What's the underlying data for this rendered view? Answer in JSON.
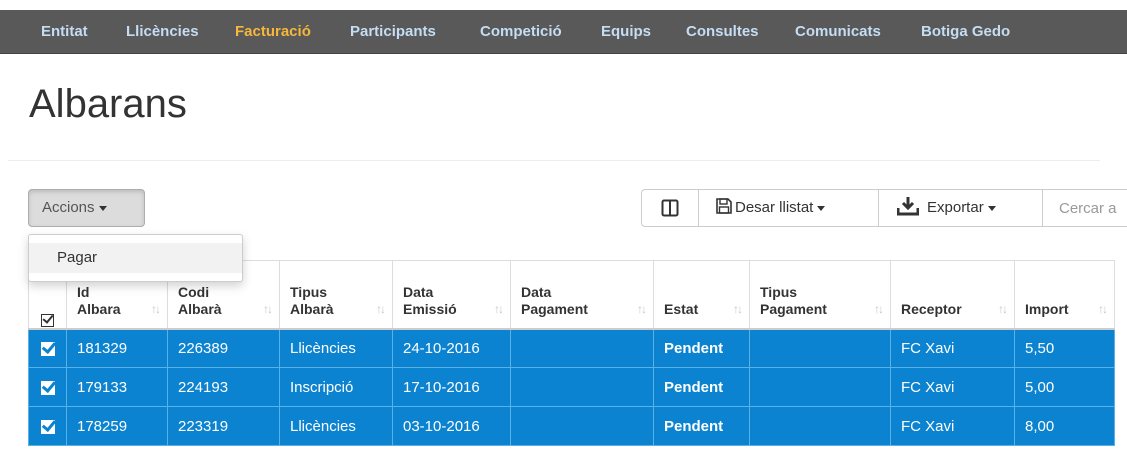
{
  "nav": {
    "items": [
      "Entitat",
      "Llicències",
      "Facturació",
      "Participants",
      "Competició",
      "Equips",
      "Consultes",
      "Comunicats",
      "Botiga Gedo"
    ],
    "active": "Facturació"
  },
  "page": {
    "title": "Albarans"
  },
  "toolbar": {
    "accions_label": "Accions",
    "columns_icon": "columns-icon",
    "desar_label": "Desar llistat",
    "desar_icon": "floppy-disk-icon",
    "exportar_label": "Exportar",
    "exportar_icon": "download-tray-icon",
    "search_placeholder": "Cercar a"
  },
  "dropdown": {
    "items": [
      "Pagar"
    ]
  },
  "table": {
    "headers": [
      [
        "Id",
        "Albara"
      ],
      [
        "Codi",
        "Albarà"
      ],
      [
        "Tipus",
        "Albarà"
      ],
      [
        "Data",
        "Emissió"
      ],
      [
        "Data",
        "Pagament"
      ],
      [
        "",
        "Estat"
      ],
      [
        "Tipus",
        "Pagament"
      ],
      [
        "",
        "Receptor"
      ],
      [
        "",
        "Import"
      ]
    ],
    "rows": [
      [
        "181329",
        "226389",
        "Llicències",
        "24-10-2016",
        "",
        "Pendent",
        "",
        "FC Xavi",
        "5,50"
      ],
      [
        "179133",
        "224193",
        "Inscripció",
        "17-10-2016",
        "",
        "Pendent",
        "",
        "FC Xavi",
        "5,00"
      ],
      [
        "178259",
        "223319",
        "Llicències",
        "03-10-2016",
        "",
        "Pendent",
        "",
        "FC Xavi",
        "8,00"
      ]
    ]
  },
  "colors": {
    "nav_bg": "#595959",
    "nav_text": "#c4ddf3",
    "nav_active": "#f6b73c",
    "row_selected": "#0b83d0"
  }
}
